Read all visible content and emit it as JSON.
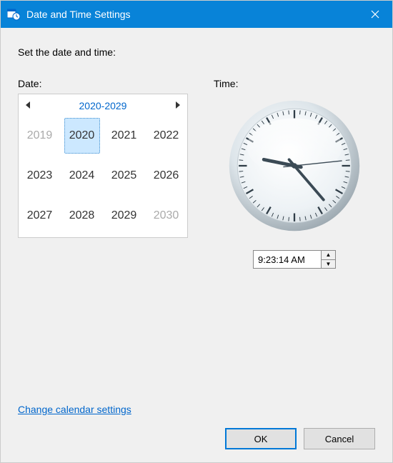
{
  "titlebar": {
    "title": "Date and Time Settings"
  },
  "instruction": "Set the date and time:",
  "labels": {
    "date": "Date:",
    "time": "Time:"
  },
  "calendar": {
    "range_label": "2020-2029",
    "years": [
      "2019",
      "2020",
      "2021",
      "2022",
      "2023",
      "2024",
      "2025",
      "2026",
      "2027",
      "2028",
      "2029",
      "2030"
    ],
    "selected_year": "2020",
    "out_of_range": [
      "2019",
      "2030"
    ]
  },
  "time": {
    "value": "9:23:14 AM",
    "hour": 9,
    "minute": 23,
    "second": 14
  },
  "link": "Change calendar settings",
  "buttons": {
    "ok": "OK",
    "cancel": "Cancel"
  }
}
